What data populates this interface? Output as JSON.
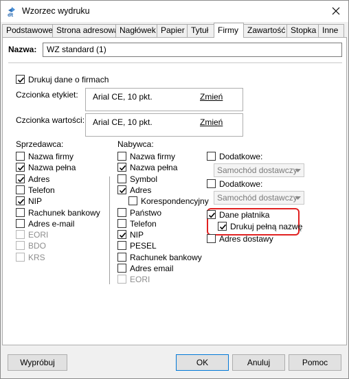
{
  "window": {
    "title": "Wzorzec wydruku",
    "app_icon": "dt-app-icon"
  },
  "tabs": [
    "Podstawowe",
    "Strona adresowa",
    "Nagłówek",
    "Papier",
    "Tytuł",
    "Firmy",
    "Zawartość",
    "Stopka",
    "Inne"
  ],
  "active_tab": "Firmy",
  "name": {
    "label": "Nazwa:",
    "value": "WZ standard (1)"
  },
  "print_companies": {
    "label": "Drukuj dane o firmach",
    "checked": true
  },
  "label_font": {
    "label": "Czcionka etykiet:",
    "value": "Arial CE, 10 pkt.",
    "link": "Zmień"
  },
  "value_font": {
    "label": "Czcionka wartości:",
    "value": "Arial CE, 10 pkt.",
    "link": "Zmień"
  },
  "seller": {
    "title": "Sprzedawca:",
    "items": [
      {
        "label": "Nazwa firmy",
        "checked": false,
        "disabled": false
      },
      {
        "label": "Nazwa pełna",
        "checked": true,
        "disabled": false
      },
      {
        "label": "Adres",
        "checked": true,
        "disabled": false
      },
      {
        "label": "Telefon",
        "checked": false,
        "disabled": false
      },
      {
        "label": "NIP",
        "checked": true,
        "disabled": false
      },
      {
        "label": "Rachunek bankowy",
        "checked": false,
        "disabled": false
      },
      {
        "label": "Adres e-mail",
        "checked": false,
        "disabled": false
      },
      {
        "label": "EORI",
        "checked": false,
        "disabled": true
      },
      {
        "label": "BDO",
        "checked": false,
        "disabled": true
      },
      {
        "label": "KRS",
        "checked": false,
        "disabled": true
      }
    ]
  },
  "buyer": {
    "title": "Nabywca:",
    "items": [
      {
        "label": "Nazwa firmy",
        "checked": false,
        "disabled": false
      },
      {
        "label": "Nazwa pełna",
        "checked": true,
        "disabled": false
      },
      {
        "label": "Symbol",
        "checked": false,
        "disabled": false
      },
      {
        "label": "Adres",
        "checked": true,
        "disabled": false
      },
      {
        "label": "Korespondencyjny",
        "checked": false,
        "disabled": false,
        "indent": true
      },
      {
        "label": "Państwo",
        "checked": false,
        "disabled": false
      },
      {
        "label": "Telefon",
        "checked": false,
        "disabled": false
      },
      {
        "label": "NIP",
        "checked": true,
        "disabled": false
      },
      {
        "label": "PESEL",
        "checked": false,
        "disabled": false
      },
      {
        "label": "Rachunek bankowy",
        "checked": false,
        "disabled": false
      },
      {
        "label": "Adres email",
        "checked": false,
        "disabled": false
      },
      {
        "label": "EORI",
        "checked": false,
        "disabled": true
      }
    ]
  },
  "extra": {
    "additional1": {
      "label": "Dodatkowe:",
      "checked": false,
      "select_value": "Samochód dostawczy"
    },
    "additional2": {
      "label": "Dodatkowe:",
      "checked": false,
      "select_value": "Samochód dostawczy"
    },
    "payer": {
      "label": "Dane płatnika",
      "checked": true
    },
    "payer_full_name": {
      "label": "Drukuj pełną nazwę",
      "checked": true
    },
    "delivery_address": {
      "label": "Adres dostawy",
      "checked": false
    }
  },
  "buttons": {
    "preview": "Wypróbuj",
    "ok": "OK",
    "cancel": "Anuluj",
    "help": "Pomoc"
  },
  "colors": {
    "highlight": "#e02020",
    "focus": "#0078d7"
  }
}
